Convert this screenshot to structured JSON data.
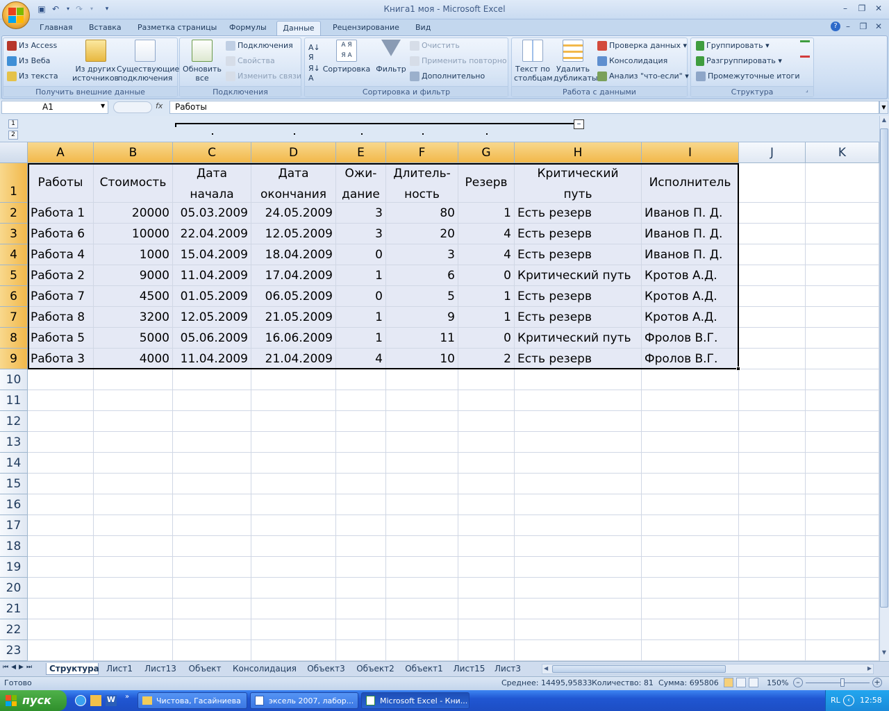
{
  "window": {
    "title": "Книга1 моя - Microsoft Excel"
  },
  "ribbon": {
    "tabs": [
      "Главная",
      "Вставка",
      "Разметка страницы",
      "Формулы",
      "Данные",
      "Рецензирование",
      "Вид"
    ],
    "active_tab": "Данные",
    "groups": {
      "external": {
        "label": "Получить внешние данные",
        "from_access": "Из Access",
        "from_web": "Из Веба",
        "from_text": "Из текста",
        "other_sources_1": "Из других",
        "other_sources_2": "источников",
        "existing_1": "Существующие",
        "existing_2": "подключения"
      },
      "connections": {
        "label": "Подключения",
        "refresh_1": "Обновить",
        "refresh_2": "все",
        "connections": "Подключения",
        "properties": "Свойства",
        "edit_links": "Изменить связи"
      },
      "sort_filter": {
        "label": "Сортировка и фильтр",
        "sort": "Сортировка",
        "filter": "Фильтр",
        "clear": "Очистить",
        "reapply": "Применить повторно",
        "advanced": "Дополнительно"
      },
      "data_tools": {
        "label": "Работа с данными",
        "text_to_cols_1": "Текст по",
        "text_to_cols_2": "столбцам",
        "remove_dup_1": "Удалить",
        "remove_dup_2": "дубликаты",
        "validation": "Проверка данных",
        "consolidate": "Консолидация",
        "whatif": "Анализ \"что-если\""
      },
      "outline": {
        "label": "Структура",
        "group": "Группировать",
        "ungroup": "Разгруппировать",
        "subtotal": "Промежуточные итоги"
      }
    }
  },
  "formula_bar": {
    "name_box": "A1",
    "fx": "fx",
    "formula": "Работы"
  },
  "outline_levels": [
    "1",
    "2"
  ],
  "grid": {
    "columns": [
      "A",
      "B",
      "C",
      "D",
      "E",
      "F",
      "G",
      "H",
      "I",
      "J",
      "K"
    ],
    "rows": [
      "1",
      "2",
      "3",
      "4",
      "5",
      "6",
      "7",
      "8",
      "9",
      "10",
      "11",
      "12",
      "13",
      "14",
      "15",
      "16",
      "17",
      "18",
      "19",
      "20",
      "21",
      "22",
      "23"
    ],
    "header": {
      "a": "Работы",
      "b": "Стоимость",
      "c1": "Дата",
      "c2": "начала",
      "d1": "Дата",
      "d2": "окончания",
      "e1": "Ожи-",
      "e2": "дание",
      "f1": "Длитель-",
      "f2": "ность",
      "g": "Резерв",
      "h1": "Критический",
      "h2": "путь",
      "i": "Исполнитель"
    },
    "data": [
      [
        "Работа 1",
        "20000",
        "05.03.2009",
        "24.05.2009",
        "3",
        "80",
        "1",
        "Есть резерв",
        "Иванов П. Д."
      ],
      [
        "Работа 6",
        "10000",
        "22.04.2009",
        "12.05.2009",
        "3",
        "20",
        "4",
        "Есть резерв",
        "Иванов П. Д."
      ],
      [
        "Работа 4",
        "1000",
        "15.04.2009",
        "18.04.2009",
        "0",
        "3",
        "4",
        "Есть резерв",
        "Иванов П. Д."
      ],
      [
        "Работа 2",
        "9000",
        "11.04.2009",
        "17.04.2009",
        "1",
        "6",
        "0",
        "Критический путь",
        "Кротов А.Д."
      ],
      [
        "Работа 7",
        "4500",
        "01.05.2009",
        "06.05.2009",
        "0",
        "5",
        "1",
        "Есть резерв",
        "Кротов А.Д."
      ],
      [
        "Работа 8",
        "3200",
        "12.05.2009",
        "21.05.2009",
        "1",
        "9",
        "1",
        "Есть резерв",
        "Кротов А.Д."
      ],
      [
        "Работа 5",
        "5000",
        "05.06.2009",
        "16.06.2009",
        "1",
        "11",
        "0",
        "Критический путь",
        "Фролов В.Г."
      ],
      [
        "Работа 3",
        "4000",
        "11.04.2009",
        "21.04.2009",
        "4",
        "10",
        "2",
        "Есть резерв",
        "Фролов В.Г."
      ]
    ]
  },
  "sheets": [
    "Структура",
    "Лист1",
    "Лист13",
    "Объект",
    "Консолидация",
    "Объект3",
    "Объект2",
    "Объект1",
    "Лист15",
    "Лист3"
  ],
  "active_sheet": "Структура",
  "status": {
    "ready": "Готово",
    "average": "Среднее: 14495,95833",
    "count": "Количество: 81",
    "sum": "Сумма: 695806",
    "zoom": "150%"
  },
  "taskbar": {
    "start": "пуск",
    "tasks": [
      "Чистова, Гасайниева",
      "эксель 2007, лабор...",
      "Microsoft Excel - Кни..."
    ],
    "lang": "RL",
    "clock": "12:58"
  }
}
